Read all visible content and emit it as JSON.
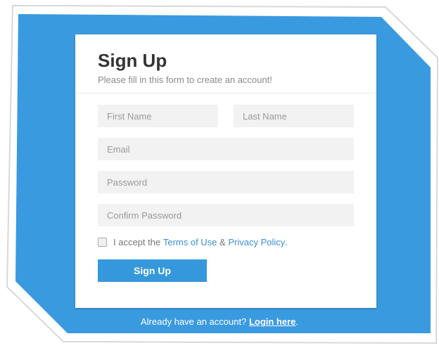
{
  "colors": {
    "background": "#3a9ae0",
    "button": "#3598dc",
    "link": "#3a8fd1"
  },
  "form": {
    "title": "Sign Up",
    "subtitle": "Please fill in this form to create an account!",
    "first_name_placeholder": "First Name",
    "last_name_placeholder": "Last Name",
    "email_placeholder": "Email",
    "password_placeholder": "Password",
    "confirm_password_placeholder": "Confirm Password",
    "accept_prefix": "I accept the",
    "terms_link": "Terms of Use",
    "ampersand": "&",
    "privacy_link": "Privacy Policy",
    "accept_suffix": ".",
    "submit_label": "Sign Up"
  },
  "footer": {
    "prompt": "Already have an account?",
    "login_link": "Login here",
    "suffix": "."
  }
}
